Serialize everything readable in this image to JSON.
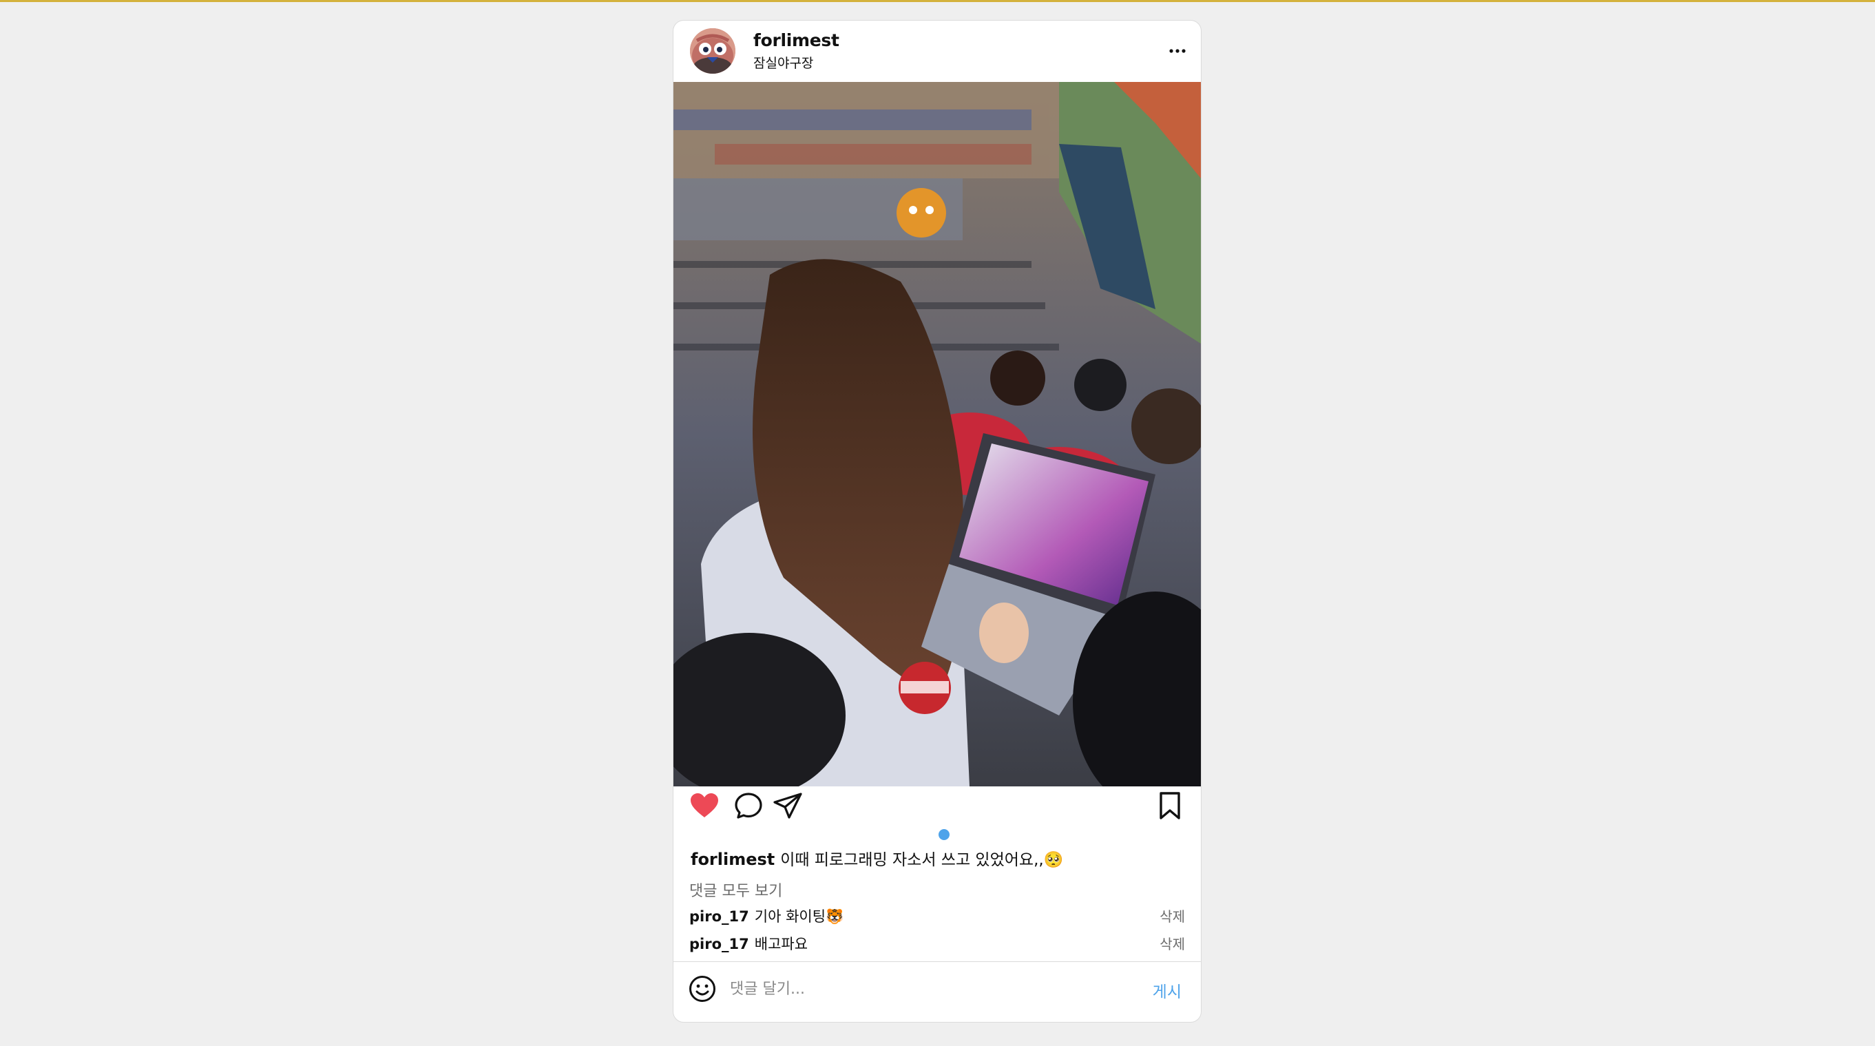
{
  "page": {
    "accent": "#d4b23c",
    "background": "#efefef"
  },
  "post": {
    "username": "forlimest",
    "location": "잠실야구장",
    "avatar_icon": "mascot-avatar",
    "photo_description_icon": "post-photo",
    "liked": true,
    "like_color": "#ed4956",
    "carousel_dot_color": "#4ea3ea",
    "caption": {
      "username": "forlimest",
      "text": "이때 피로그래밍 자소서 쓰고 있었어요,,🥺"
    },
    "view_all_comments": "댓글 모두 보기",
    "comments": [
      {
        "username": "piro_17",
        "text": "기아 화이팅🐯",
        "delete_label": "삭제"
      },
      {
        "username": "piro_17",
        "text": "배고파요",
        "delete_label": "삭제"
      }
    ],
    "comment_input": {
      "placeholder": "댓글 달기...",
      "value": ""
    },
    "post_button": "게시"
  }
}
